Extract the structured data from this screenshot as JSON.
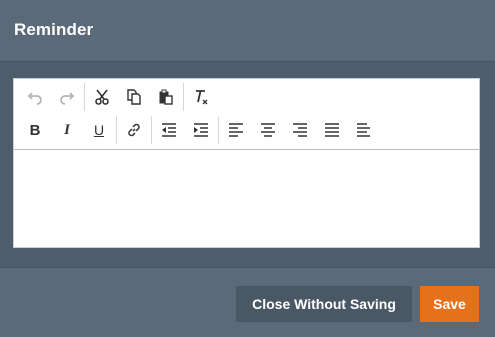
{
  "dialog": {
    "title": "Reminder"
  },
  "toolbar": {
    "row1": [
      {
        "name": "undo-icon",
        "enabled": false
      },
      {
        "name": "redo-icon",
        "enabled": false
      },
      {
        "name": "cut-icon",
        "enabled": true
      },
      {
        "name": "copy-icon",
        "enabled": true
      },
      {
        "name": "paste-icon",
        "enabled": true
      },
      {
        "name": "remove-format-icon",
        "enabled": true
      }
    ],
    "row2": [
      {
        "name": "bold-icon",
        "glyph": "B"
      },
      {
        "name": "italic-icon",
        "glyph": "I"
      },
      {
        "name": "underline-icon",
        "glyph": "U"
      },
      {
        "name": "link-icon"
      },
      {
        "name": "outdent-icon"
      },
      {
        "name": "indent-icon"
      },
      {
        "name": "align-left-icon"
      },
      {
        "name": "align-center-icon"
      },
      {
        "name": "align-right-icon"
      },
      {
        "name": "align-justify-icon"
      },
      {
        "name": "align-left-2-icon"
      }
    ]
  },
  "editor": {
    "content": ""
  },
  "footer": {
    "close_label": "Close Without Saving",
    "save_label": "Save"
  },
  "colors": {
    "header": "#5b6a79",
    "body": "#4e5d6c",
    "close_button": "#4a5866",
    "save_button": "#e6711b"
  }
}
